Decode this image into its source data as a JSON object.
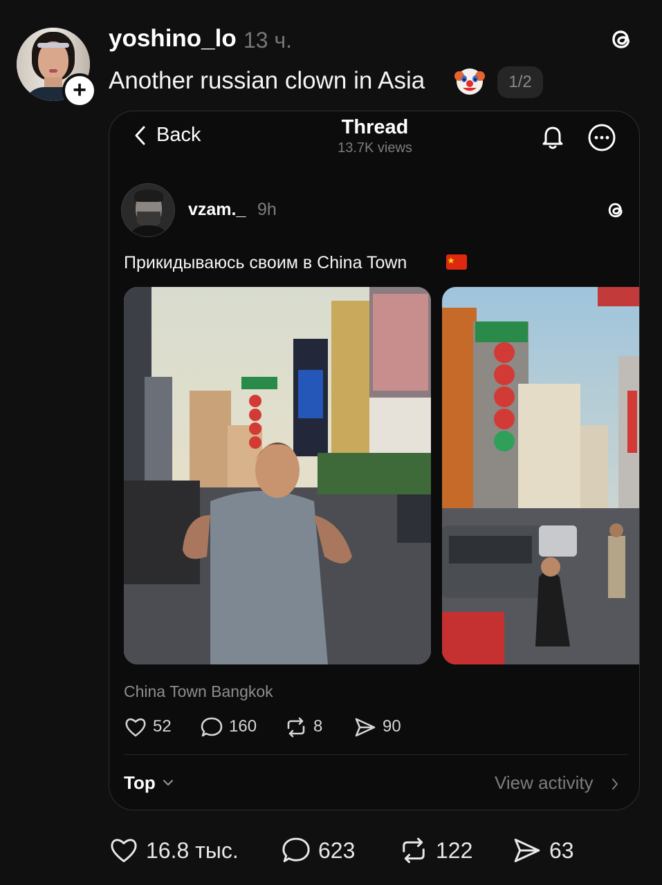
{
  "post": {
    "username": "yoshino_lo",
    "time": "13 ч.",
    "caption": "Another russian clown in Asia",
    "caption_emoji": "clown-face-icon",
    "page_indicator": "1/2",
    "follow_symbol": "+"
  },
  "embedded": {
    "nav": {
      "back_label": "Back",
      "title": "Thread",
      "views": "13.7K views"
    },
    "author": "vzam._",
    "time": "9h",
    "text": "Прикидываюсь своим в China Town",
    "flag": "china-flag-icon",
    "location": "China Town Bangkok",
    "stats": {
      "likes": "52",
      "replies": "160",
      "reposts": "8",
      "shares": "90"
    },
    "sort_label": "Top",
    "view_activity_label": "View activity"
  },
  "stats": {
    "likes": "16.8 тыс.",
    "replies": "623",
    "reposts": "122",
    "shares": "63"
  },
  "colors": {
    "background": "#101010",
    "text": "#f3f5f7",
    "muted": "#777777"
  }
}
